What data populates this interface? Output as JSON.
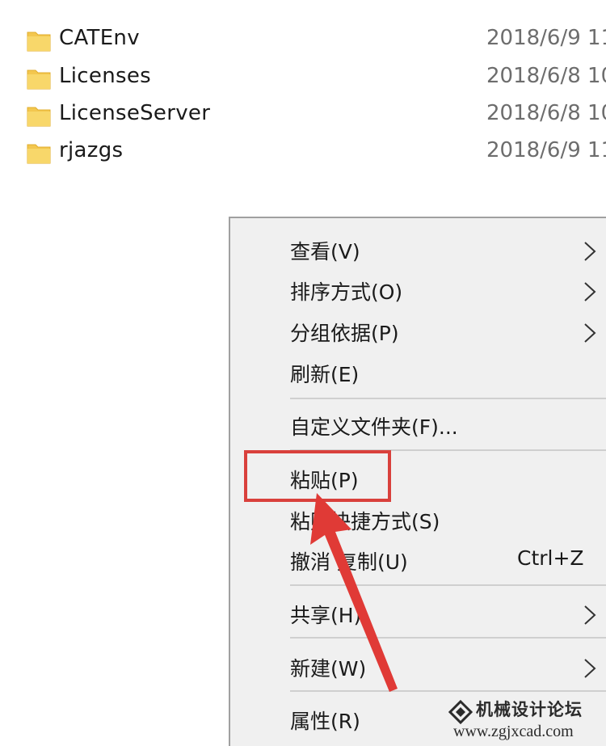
{
  "files": [
    {
      "name": "CATEnv",
      "date": "2018/6/9 11"
    },
    {
      "name": "Licenses",
      "date": "2018/6/8 10"
    },
    {
      "name": "LicenseServer",
      "date": "2018/6/8 10"
    },
    {
      "name": "rjazgs",
      "date": "2018/6/9 11"
    }
  ],
  "context_menu": {
    "items": [
      {
        "label": "查看(V)",
        "has_submenu": true
      },
      {
        "label": "排序方式(O)",
        "has_submenu": true
      },
      {
        "label": "分组依据(P)",
        "has_submenu": true
      },
      {
        "label": "刷新(E)",
        "has_submenu": false
      },
      {
        "label": "自定义文件夹(F)...",
        "has_submenu": false
      },
      {
        "label": "粘贴(P)",
        "has_submenu": false,
        "highlighted": true
      },
      {
        "label": "粘贴快捷方式(S)",
        "has_submenu": false
      },
      {
        "label": "撤消 复制(U)",
        "shortcut": "Ctrl+Z",
        "has_submenu": false
      },
      {
        "label": "共享(H)",
        "has_submenu": true
      },
      {
        "label": "新建(W)",
        "has_submenu": true
      },
      {
        "label": "属性(R)",
        "has_submenu": false
      }
    ]
  },
  "annotation": {
    "highlight_color": "#d9403c",
    "arrow_color": "#e03a36"
  },
  "watermark": {
    "title": "机械设计论坛",
    "url": "www.zgjxcad.com"
  },
  "colors": {
    "folder": "#f3c74f",
    "menu_bg": "#f0f0f0"
  }
}
